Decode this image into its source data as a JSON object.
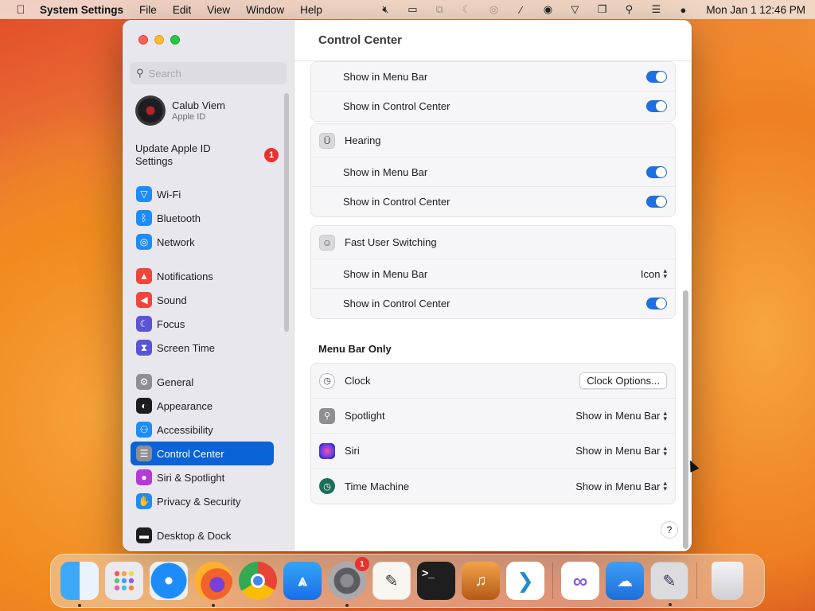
{
  "menubar": {
    "app_name": "System Settings",
    "items": [
      "File",
      "Edit",
      "View",
      "Window",
      "Help"
    ],
    "clock": "Mon Jan 1  12:46 PM"
  },
  "sidebar": {
    "search_placeholder": "Search",
    "profile": {
      "name": "Calub Viem",
      "sub": "Apple ID"
    },
    "update": {
      "label": "Update Apple ID Settings",
      "badge": "1"
    },
    "items": [
      {
        "label": "Wi-Fi",
        "icon": "wifi-icon",
        "color": "#1d8cf8"
      },
      {
        "label": "Bluetooth",
        "icon": "bluetooth-icon",
        "color": "#1d8cf8"
      },
      {
        "label": "Network",
        "icon": "globe-icon",
        "color": "#1d8cf8"
      },
      {
        "label": "Notifications",
        "icon": "bell-icon",
        "color": "#f0453a"
      },
      {
        "label": "Sound",
        "icon": "speaker-icon",
        "color": "#f0453a"
      },
      {
        "label": "Focus",
        "icon": "moon-icon",
        "color": "#5b55d6"
      },
      {
        "label": "Screen Time",
        "icon": "hourglass-icon",
        "color": "#5b55d6"
      },
      {
        "label": "General",
        "icon": "gear-icon",
        "color": "#8e8e93"
      },
      {
        "label": "Appearance",
        "icon": "appearance-icon",
        "color": "#1d1d1f"
      },
      {
        "label": "Accessibility",
        "icon": "accessibility-icon",
        "color": "#1d8cf8"
      },
      {
        "label": "Control Center",
        "icon": "control-center-icon",
        "color": "#8e8e93"
      },
      {
        "label": "Siri & Spotlight",
        "icon": "siri-icon",
        "color": "#b43ad6"
      },
      {
        "label": "Privacy & Security",
        "icon": "hand-icon",
        "color": "#1d8cf8"
      },
      {
        "label": "Desktop & Dock",
        "icon": "dock-icon",
        "color": "#1d1d1f"
      }
    ]
  },
  "main": {
    "title": "Control Center",
    "top_group": {
      "rows": [
        "Show in Menu Bar",
        "Show in Control Center"
      ]
    },
    "hearing": {
      "title": "Hearing",
      "rows": [
        "Show in Menu Bar",
        "Show in Control Center"
      ]
    },
    "fast_user": {
      "title": "Fast User Switching",
      "row1": "Show in Menu Bar",
      "row1_value": "Icon",
      "row2": "Show in Control Center"
    },
    "menu_bar_only": {
      "title": "Menu Bar Only",
      "clock": {
        "label": "Clock",
        "button": "Clock Options..."
      },
      "spotlight": {
        "label": "Spotlight",
        "value": "Show in Menu Bar"
      },
      "siri": {
        "label": "Siri",
        "value": "Show in Menu Bar"
      },
      "time_machine": {
        "label": "Time Machine",
        "value": "Show in Menu Bar"
      }
    },
    "help": "?"
  },
  "dock": {
    "settings_badge": "1",
    "terminal_glyph": ">_"
  }
}
